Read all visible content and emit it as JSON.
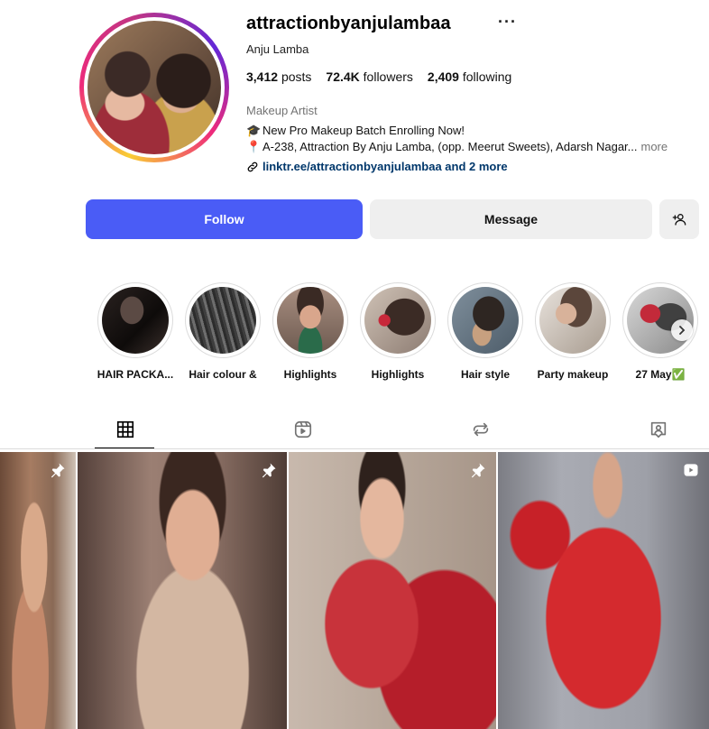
{
  "profile": {
    "username": "attractionbyanjulambaa",
    "more_icon": "ellipsis-icon",
    "full_name": "Anju Lamba",
    "stats": {
      "posts_count": "3,412",
      "posts_label": "posts",
      "followers_count": "72.4K",
      "followers_label": "followers",
      "following_count": "2,409",
      "following_label": "following"
    },
    "category": "Makeup Artist",
    "bio": {
      "line1_emoji": "🎓",
      "line1": "New Pro Makeup Batch Enrolling Now!",
      "line2_emoji": "📍",
      "line2": "A-238, Attraction By Anju Lamba, (opp. Meerut Sweets), Adarsh Nagar...",
      "more": "more"
    },
    "link": "linktr.ee/attractionbyanjulambaa and 2 more"
  },
  "actions": {
    "follow": "Follow",
    "message": "Message",
    "add_user_icon": "add-person-icon"
  },
  "highlights": [
    {
      "label": "HAIR PACKA..."
    },
    {
      "label": "Hair colour &"
    },
    {
      "label": "Highlights"
    },
    {
      "label": "Highlights"
    },
    {
      "label": "Hair style"
    },
    {
      "label": "Party makeup"
    },
    {
      "label": "27 May✅"
    }
  ],
  "tabs": [
    {
      "icon": "grid-icon",
      "active": true
    },
    {
      "icon": "reels-icon",
      "active": false
    },
    {
      "icon": "reposts-icon",
      "active": false
    },
    {
      "icon": "tagged-icon",
      "active": false
    }
  ],
  "posts": [
    {
      "badge": "pin-icon"
    },
    {
      "badge": "pin-icon"
    },
    {
      "badge": "pin-icon"
    },
    {
      "badge": "reel-icon"
    }
  ],
  "colors": {
    "follow_button": "#4a5cf6",
    "link": "#00376b",
    "secondary_button": "#efefef"
  }
}
